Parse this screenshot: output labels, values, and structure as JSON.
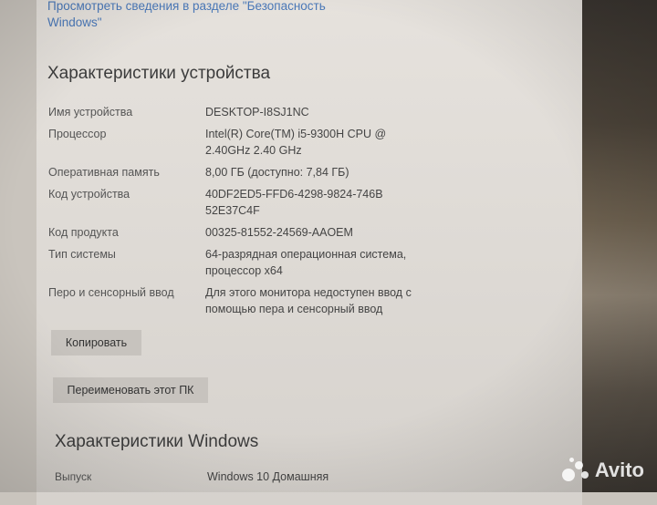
{
  "security_link": "Просмотреть сведения в разделе \"Безопасность Windows\"",
  "device_specs": {
    "title": "Характеристики устройства",
    "rows": [
      {
        "label": "Имя устройства",
        "value": "DESKTOP-I8SJ1NC"
      },
      {
        "label": "Процессор",
        "value": "Intel(R) Core(TM) i5-9300H CPU @ 2.40GHz   2.40 GHz"
      },
      {
        "label": "Оперативная память",
        "value": "8,00 ГБ (доступно: 7,84 ГБ)"
      },
      {
        "label": "Код устройства",
        "value": "40DF2ED5-FFD6-4298-9824-746B52E37C4F"
      },
      {
        "label": "Код продукта",
        "value": "00325-81552-24569-AAOEM"
      },
      {
        "label": "Тип системы",
        "value": "64-разрядная операционная система, процессор x64"
      },
      {
        "label": "Перо и сенсорный ввод",
        "value": "Для этого монитора недоступен ввод с помощью пера и сенсорный ввод"
      }
    ],
    "copy_button": "Копировать",
    "rename_button": "Переименовать этот ПК"
  },
  "windows_specs": {
    "title": "Характеристики Windows",
    "rows": [
      {
        "label": "Выпуск",
        "value": "Windows 10 Домашняя"
      }
    ]
  },
  "watermark": "Avito"
}
